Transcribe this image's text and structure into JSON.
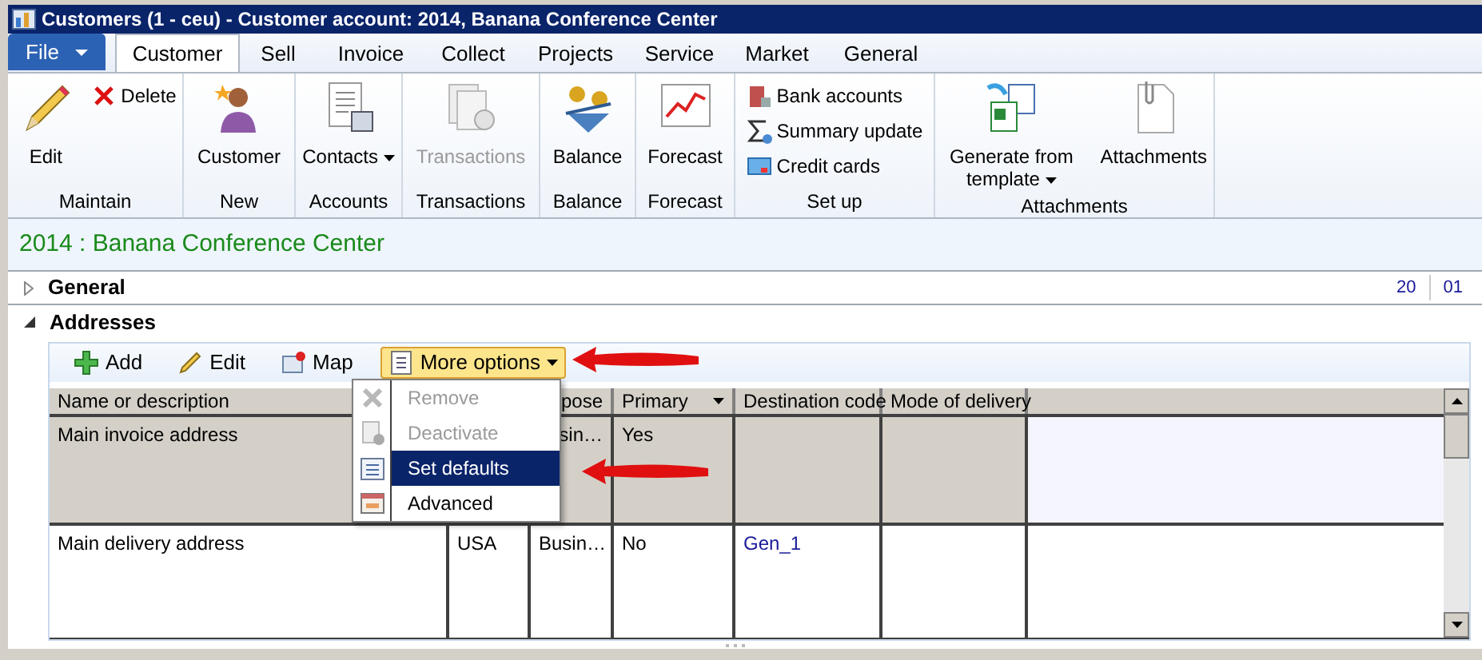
{
  "window": {
    "title": "Customers (1 - ceu) - Customer account: 2014, Banana Conference Center"
  },
  "file_menu": {
    "label": "File"
  },
  "tabs": [
    {
      "label": "Customer",
      "selected": true
    },
    {
      "label": "Sell",
      "selected": false
    },
    {
      "label": "Invoice",
      "selected": false
    },
    {
      "label": "Collect",
      "selected": false
    },
    {
      "label": "Projects",
      "selected": false
    },
    {
      "label": "Service",
      "selected": false
    },
    {
      "label": "Market",
      "selected": false
    },
    {
      "label": "General",
      "selected": false
    }
  ],
  "ribbon": {
    "groups": [
      {
        "label": "Maintain",
        "buttons": [
          {
            "kind": "large",
            "label": "Edit",
            "disabled": false,
            "dropdown": false
          },
          {
            "kind": "small",
            "label": "Delete",
            "disabled": false,
            "dropdown": false
          }
        ]
      },
      {
        "label": "New",
        "buttons": [
          {
            "kind": "large",
            "label": "Customer",
            "disabled": false,
            "dropdown": false
          }
        ]
      },
      {
        "label": "Accounts",
        "buttons": [
          {
            "kind": "large",
            "label": "Contacts",
            "disabled": false,
            "dropdown": true
          }
        ]
      },
      {
        "label": "Transactions",
        "buttons": [
          {
            "kind": "large",
            "label": "Transactions",
            "disabled": true,
            "dropdown": false
          }
        ]
      },
      {
        "label": "Balance",
        "buttons": [
          {
            "kind": "large",
            "label": "Balance",
            "disabled": false,
            "dropdown": false
          }
        ]
      },
      {
        "label": "Forecast",
        "buttons": [
          {
            "kind": "large",
            "label": "Forecast",
            "disabled": false,
            "dropdown": false
          }
        ]
      },
      {
        "label": "Set up",
        "buttons": [
          {
            "kind": "small",
            "label": "Bank accounts",
            "disabled": false,
            "dropdown": false
          },
          {
            "kind": "small",
            "label": "Summary update",
            "disabled": false,
            "dropdown": false
          },
          {
            "kind": "small",
            "label": "Credit cards",
            "disabled": false,
            "dropdown": false
          }
        ]
      },
      {
        "label": "Attachments",
        "buttons": [
          {
            "kind": "large",
            "label": "Generate from template",
            "disabled": false,
            "dropdown": true
          },
          {
            "kind": "large",
            "label": "Attachments",
            "disabled": false,
            "dropdown": false
          }
        ]
      }
    ]
  },
  "record_title": "2014 : Banana Conference Center",
  "sections": [
    {
      "label": "General",
      "expanded": false,
      "summary_values": [
        "20",
        "01"
      ]
    },
    {
      "label": "Addresses",
      "expanded": true
    }
  ],
  "toolbar": [
    {
      "label": "Add",
      "open": false,
      "dropdown": false
    },
    {
      "label": "Edit",
      "open": false,
      "dropdown": false
    },
    {
      "label": "Map",
      "open": false,
      "dropdown": false
    },
    {
      "label": "More options",
      "open": true,
      "dropdown": true
    }
  ],
  "menu": {
    "items": [
      {
        "label": "Remove",
        "disabled": true,
        "selected": false
      },
      {
        "label": "Deactivate",
        "disabled": true,
        "selected": false
      },
      {
        "label": "Set defaults",
        "disabled": false,
        "selected": true
      },
      {
        "label": "Advanced",
        "disabled": false,
        "selected": false
      }
    ]
  },
  "table": {
    "columns": [
      {
        "label": "Name or description"
      },
      {},
      {
        "label": "pose",
        "partly_hidden": true
      },
      {
        "label": "Primary",
        "filter": true
      },
      {
        "label": "Destination code"
      },
      {
        "label": "Mode of delivery"
      }
    ],
    "rows": [
      {
        "selected": true,
        "cells": [
          {
            "text": "Main invoice address",
            "link": false
          },
          {},
          {
            "text": "sin…",
            "partly_hidden": true,
            "link": false
          },
          {
            "text": "Yes",
            "link": false
          },
          {},
          {}
        ]
      },
      {
        "selected": false,
        "cells": [
          {
            "text": "Main delivery address",
            "link": false
          },
          {
            "text": "USA",
            "link": false
          },
          {
            "text": "Busin…",
            "link": false
          },
          {
            "text": "No",
            "link": false
          },
          {
            "text": "Gen_1",
            "link": true
          },
          {}
        ]
      }
    ]
  }
}
